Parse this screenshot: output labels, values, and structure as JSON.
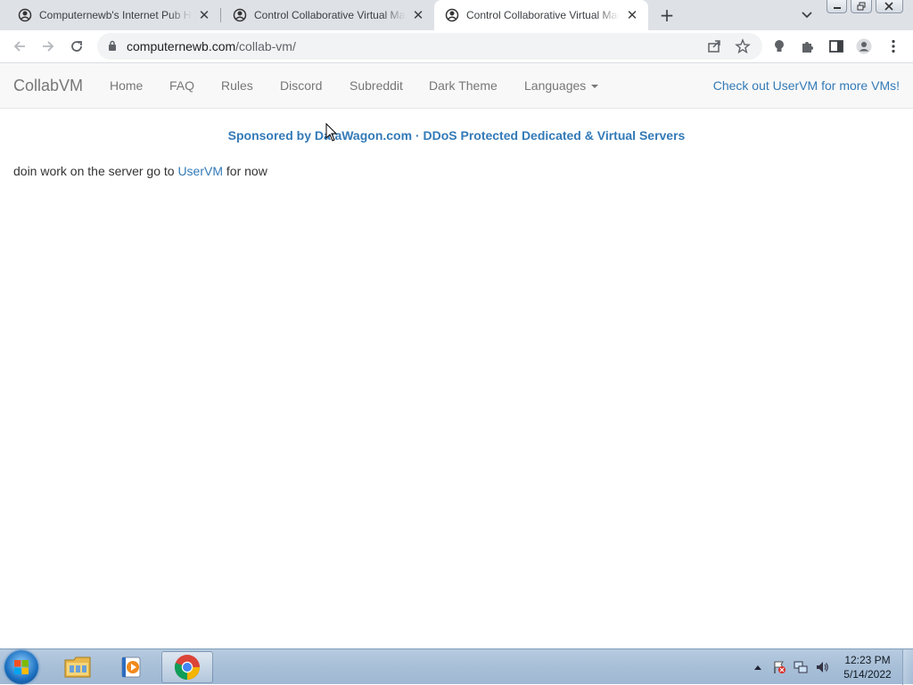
{
  "browser": {
    "tabs": [
      {
        "title": "Computernewb's Internet Pub Hub",
        "icon": "computernewb-favicon",
        "active": false
      },
      {
        "title": "Control Collaborative Virtual Machines",
        "icon": "computernewb-favicon",
        "active": false
      },
      {
        "title": "Control Collaborative Virtual Machines",
        "icon": "computernewb-favicon",
        "active": true
      }
    ],
    "url_host": "computernewb.com",
    "url_path": "/collab-vm/"
  },
  "navbar": {
    "brand": "CollabVM",
    "items": [
      "Home",
      "FAQ",
      "Rules",
      "Discord",
      "Subreddit",
      "Dark Theme",
      "Languages"
    ],
    "right_link": "Check out UserVM for more VMs!"
  },
  "content": {
    "sponsor": "Sponsored by DataWagon.com · DDoS Protected Dedicated & Virtual Servers",
    "message_before": "doin work on the server go to ",
    "message_link": "UserVM",
    "message_after": " for now"
  },
  "taskbar": {
    "time": "12:23 PM",
    "date": "5/14/2022",
    "apps": [
      "windows-explorer",
      "media-player",
      "google-chrome"
    ]
  },
  "colors": {
    "link": "#337ab7",
    "navbar_bg": "#f8f8f8",
    "tabstrip_bg": "#dee1e6"
  }
}
